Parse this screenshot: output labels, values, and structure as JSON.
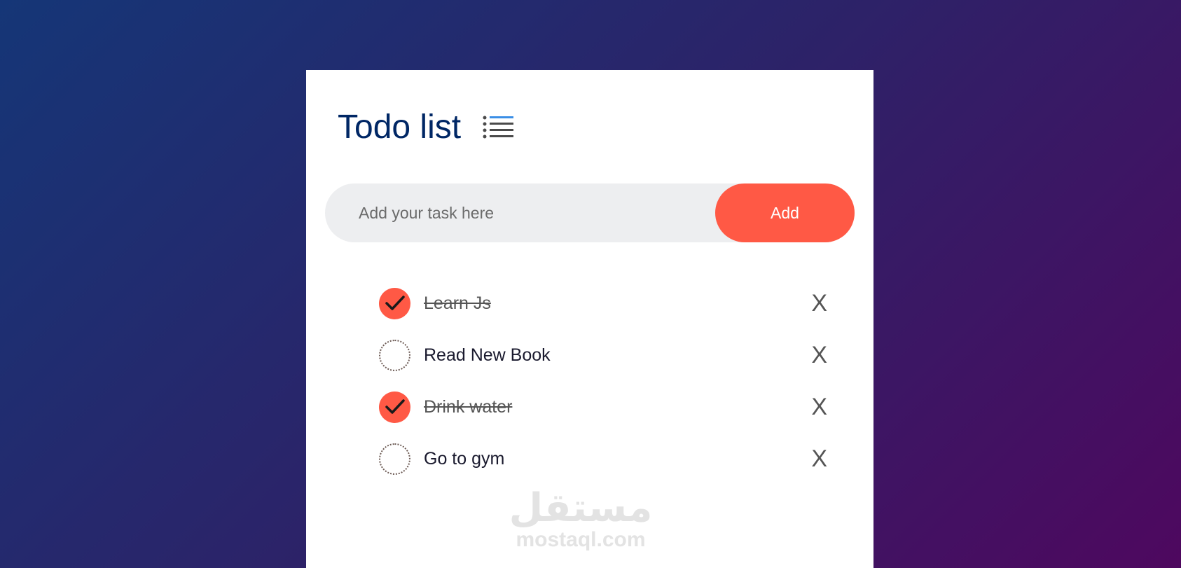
{
  "app": {
    "title": "Todo list",
    "title_icon": "list-icon"
  },
  "input": {
    "placeholder": "Add your task here",
    "value": "",
    "add_label": "Add"
  },
  "todos": [
    {
      "text": "Learn Js",
      "checked": true,
      "delete_label": "X"
    },
    {
      "text": "Read New Book",
      "checked": false,
      "delete_label": "X"
    },
    {
      "text": "Drink water",
      "checked": true,
      "delete_label": "X"
    },
    {
      "text": "Go to gym",
      "checked": false,
      "delete_label": "X"
    }
  ],
  "watermark": {
    "logo": "مستقل",
    "site": "mostaql.com"
  },
  "colors": {
    "accent": "#ff5945",
    "title": "#002765",
    "input_bg": "#edeef0",
    "gradient_start": "#153677",
    "gradient_end": "#4e085f"
  }
}
